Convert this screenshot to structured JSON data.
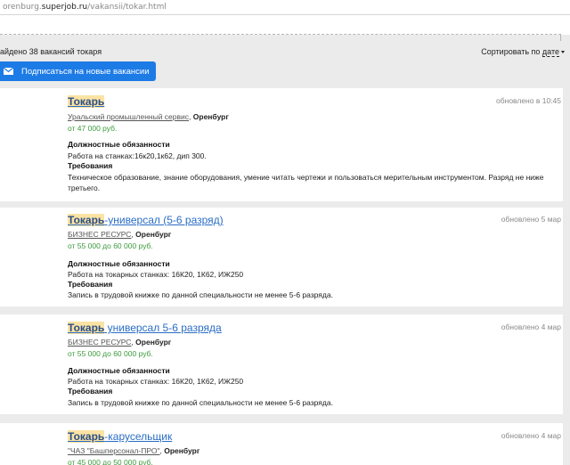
{
  "address_bar": {
    "prefix": "orenburg.",
    "host": "superjob.ru",
    "path": "/vakansii/tokar.html"
  },
  "results": {
    "found_text": "айдено 38 вакансий токаря",
    "sort_label": "Сортировать по ",
    "sort_value": "дате",
    "subscribe_label": "Подписаться на новые вакансии"
  },
  "colors": {
    "accent": "#1d7be6",
    "link": "#2a6dc5",
    "highlight": "#fbe3a3",
    "salary": "#3c9a3c"
  },
  "vacancies": [
    {
      "title_highlight": "Токарь",
      "title_rest": "",
      "updated": "обновлено в 10:45",
      "company": "Уральский промышленный сервис",
      "city": "Оренбург",
      "salary": "от 47 000 руб.",
      "duties_header": "Должностные обязанности",
      "duties": "Работа на станках:16к20,1к62, дип 300.",
      "req_header": "Требования",
      "requirements": "Техническое образование, знание оборудования, умение читать чертежи и пользоваться мерительным инструментом. Разряд не ниже третьего."
    },
    {
      "title_highlight": "Токарь",
      "title_rest": "-универсал (5-6 разряд)",
      "updated": "обновлено 5 мар",
      "company": "БИЗНЕС РЕСУРС",
      "city": "Оренбург",
      "salary": "от 55 000 до 60 000 руб.",
      "duties_header": "Должностные обязанности",
      "duties": "Работа на токарных станках: 16К20, 1К62, ИЖ250",
      "req_header": "Требования",
      "requirements": "Запись в трудовой книжке по данной специальности не менее 5-6 разряда."
    },
    {
      "title_highlight": "Токарь",
      "title_rest": " универсал 5-6 разряда",
      "updated": "обновлено 4 мар",
      "company": "БИЗНЕС РЕСУРС",
      "city": "Оренбург",
      "salary": "от 55 000 до 60 000 руб.",
      "duties_header": "Должностные обязанности",
      "duties": "Работа на токарных станках: 16К20, 1К62, ИЖ250",
      "req_header": "Требования",
      "requirements": "Запись в трудовой книжке по данной специальности не менее 5-6 разряда."
    },
    {
      "title_highlight": "Токарь",
      "title_rest": "-карусельщик",
      "updated": "обновлено 4 мар",
      "company": "\"ЧАЗ \"Башперсонал-ПРО\"",
      "city": "Оренбург",
      "salary": "от 45 000 до 50 000 руб."
    }
  ]
}
